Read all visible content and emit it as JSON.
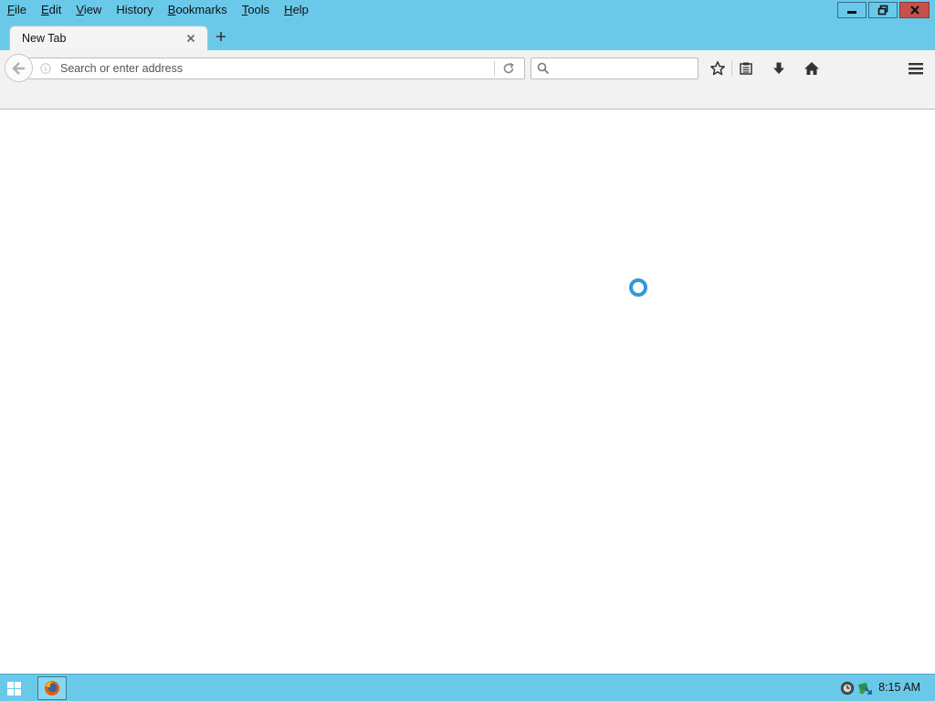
{
  "menu": {
    "items": [
      {
        "label": "File",
        "key": "F",
        "rest": "ile"
      },
      {
        "label": "Edit",
        "key": "E",
        "rest": "dit"
      },
      {
        "label": "View",
        "key": "V",
        "rest": "iew"
      },
      {
        "label": "History",
        "key": "H",
        "rest": "istory"
      },
      {
        "label": "Bookmarks",
        "key": "B",
        "rest": "ookmarks"
      },
      {
        "label": "Tools",
        "key": "T",
        "rest": "ools"
      },
      {
        "label": "Help",
        "key": "H",
        "rest": "elp"
      }
    ]
  },
  "tabs": [
    {
      "title": "New Tab",
      "active": true
    }
  ],
  "urlbar": {
    "placeholder": "Search or enter address",
    "value": ""
  },
  "searchbar": {
    "placeholder": "",
    "value": ""
  },
  "content": {
    "state": "loading"
  },
  "taskbar": {
    "clock": "8:15 AM",
    "running_apps": [
      "firefox"
    ]
  },
  "colors": {
    "chrome_accent": "#6ac9e9",
    "close_button": "#c7504b",
    "spinner": "#2f9ad8",
    "toolbar_bg": "#f2f2f2"
  },
  "icons": {
    "back": "back-arrow-icon",
    "info": "info-icon",
    "reload": "reload-icon",
    "search": "search-icon",
    "bookmark": "star-icon",
    "library": "reading-list-icon",
    "downloads": "download-arrow-icon",
    "home": "home-icon",
    "menu": "hamburger-menu-icon",
    "start": "windows-logo-icon"
  }
}
